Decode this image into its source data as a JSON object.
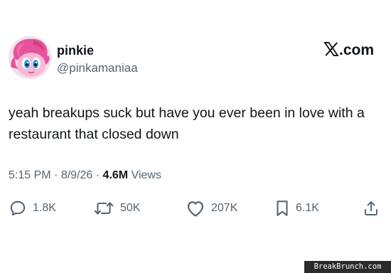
{
  "author": {
    "display_name": "pinkie",
    "handle": "@pinkamaniaa",
    "avatar_icon": "pink-pony-avatar"
  },
  "brand": {
    "logo_icon": "x-logo-icon",
    "label": ".com"
  },
  "post": {
    "text": "yeah breakups suck but have you ever been in love with a restaurant that closed down",
    "time": "5:15 PM",
    "date": "8/9/26",
    "views_count": "4.6M",
    "views_label": "Views"
  },
  "actions": {
    "reply": {
      "icon": "reply-icon",
      "count": "1.8K"
    },
    "repost": {
      "icon": "repost-icon",
      "count": "50K"
    },
    "like": {
      "icon": "heart-icon",
      "count": "207K"
    },
    "bookmark": {
      "icon": "bookmark-icon",
      "count": "6.1K"
    },
    "share": {
      "icon": "share-icon"
    }
  },
  "watermark": "BreakBrunch.com",
  "colors": {
    "text": "#0f1419",
    "secondary": "#536471",
    "avatar_pink": "#e6539a"
  }
}
